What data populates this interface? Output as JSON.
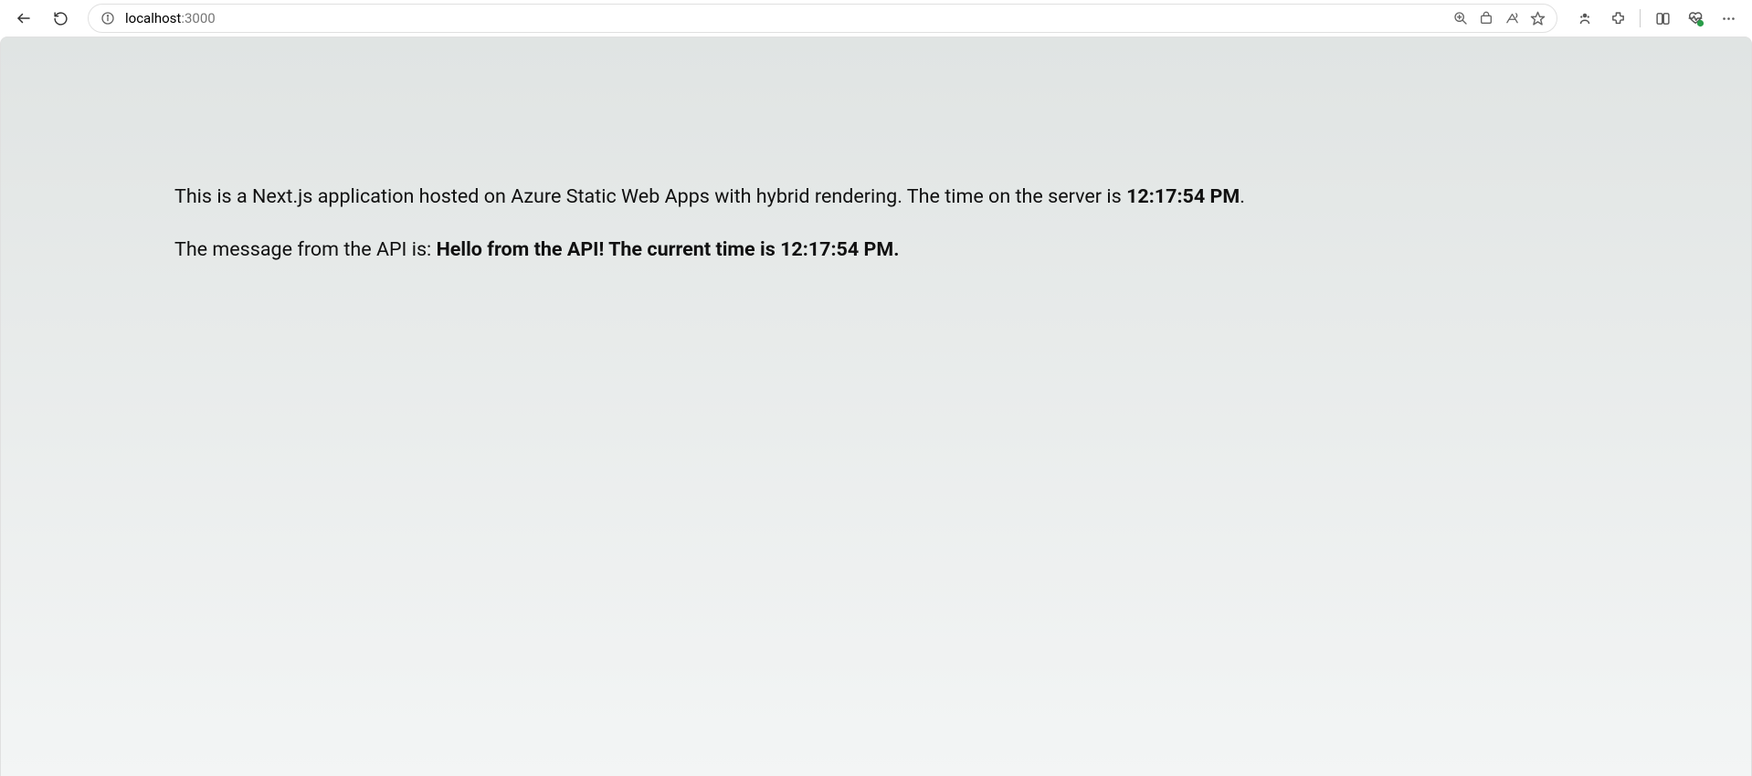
{
  "browser": {
    "address": {
      "host": "localhost",
      "port": ":3000"
    }
  },
  "page": {
    "line1_intro": "This is a Next.js application hosted on Azure Static Web Apps with hybrid rendering. The time on the server is ",
    "line1_time": "12:17:54 PM",
    "line1_period": ".",
    "line2_intro": "The message from the API is: ",
    "line2_message": "Hello from the API! The current time is 12:17:54 PM."
  }
}
